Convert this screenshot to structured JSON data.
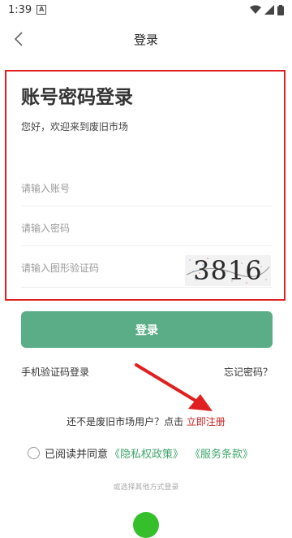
{
  "status_bar": {
    "time": "1:39",
    "notification_icon": "a-icon",
    "icons": [
      "wifi-icon",
      "signal-icon",
      "battery-icon"
    ]
  },
  "header": {
    "title": "登录",
    "back_icon": "back-arrow-icon"
  },
  "login_form": {
    "title": "账号密码登录",
    "subtitle": "您好，欢迎来到废旧市场",
    "account_placeholder": "请输入账号",
    "password_placeholder": "请输入密码",
    "captcha_placeholder": "请输入图形验证码",
    "captcha_text": "3816",
    "login_button": "登录"
  },
  "links": {
    "sms_login": "手机验证码登录",
    "forgot_password": "忘记密码？",
    "register_prompt": "还不是废旧市场用户？点击",
    "register_link": "立即注册"
  },
  "agreement": {
    "text": "已阅读并同意",
    "privacy_policy": "《隐私权政策》",
    "service_terms": "《服务条款》"
  },
  "other_login": {
    "label": "或选择其他方式登录",
    "wechat_icon": "wechat-icon"
  },
  "colors": {
    "primary_green": "#5bad87",
    "highlight_red": "#e02020",
    "link_green": "#3fa56b"
  }
}
